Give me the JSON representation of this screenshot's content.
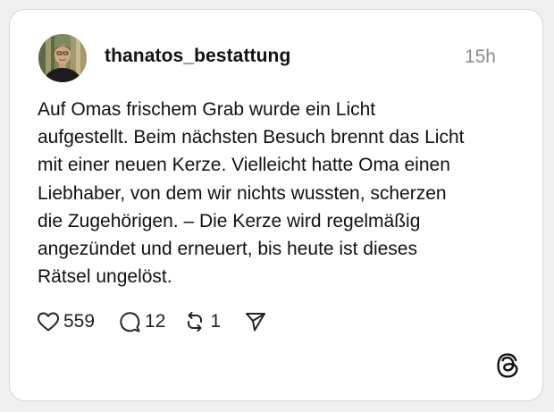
{
  "post": {
    "username": "thanatos_bestattung",
    "timestamp": "15h",
    "text": "Auf Omas frischem Grab wurde ein Licht\naufgestellt. Beim nächsten Besuch brennt das Licht\nmit einer neuen Kerze. Vielleicht hatte Oma einen\nLiebhaber, von dem wir nichts wussten, scherzen\ndie Zugehörigen. – Die Kerze wird regelmäßig\nangezündet und erneuert, bis heute ist dieses\nRätsel ungelöst."
  },
  "actions": {
    "likes": "559",
    "replies": "12",
    "reposts": "1",
    "like_icon": "heart-icon",
    "reply_icon": "speech-bubble-icon",
    "repost_icon": "repost-icon",
    "share_icon": "send-icon"
  },
  "brand": {
    "logo_icon": "threads-logo-icon"
  },
  "colors": {
    "background": "#f0f0f0",
    "card": "#ffffff",
    "text": "#111111",
    "muted": "#8e8e8e"
  }
}
